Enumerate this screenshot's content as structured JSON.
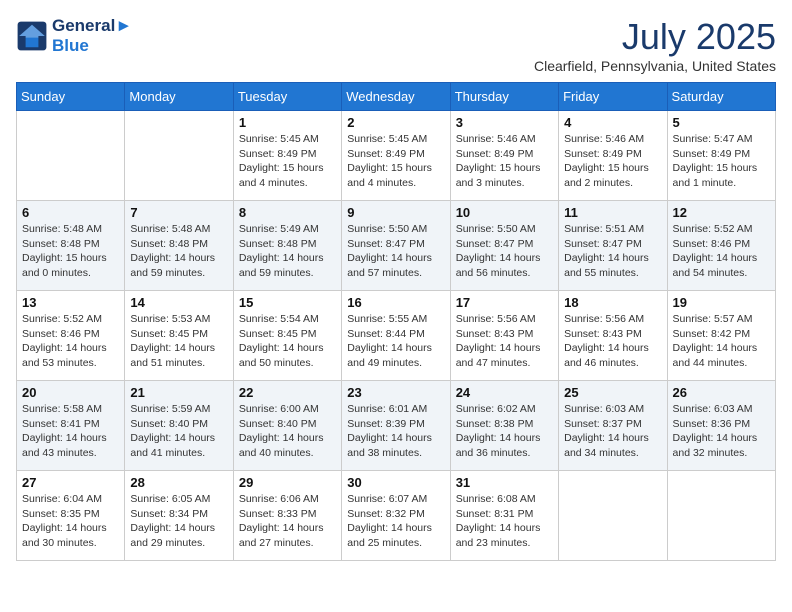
{
  "header": {
    "logo_line1": "General",
    "logo_line2": "Blue",
    "month": "July 2025",
    "location": "Clearfield, Pennsylvania, United States"
  },
  "days_of_week": [
    "Sunday",
    "Monday",
    "Tuesday",
    "Wednesday",
    "Thursday",
    "Friday",
    "Saturday"
  ],
  "weeks": [
    [
      {
        "day": "",
        "content": ""
      },
      {
        "day": "",
        "content": ""
      },
      {
        "day": "1",
        "content": "Sunrise: 5:45 AM\nSunset: 8:49 PM\nDaylight: 15 hours\nand 4 minutes."
      },
      {
        "day": "2",
        "content": "Sunrise: 5:45 AM\nSunset: 8:49 PM\nDaylight: 15 hours\nand 4 minutes."
      },
      {
        "day": "3",
        "content": "Sunrise: 5:46 AM\nSunset: 8:49 PM\nDaylight: 15 hours\nand 3 minutes."
      },
      {
        "day": "4",
        "content": "Sunrise: 5:46 AM\nSunset: 8:49 PM\nDaylight: 15 hours\nand 2 minutes."
      },
      {
        "day": "5",
        "content": "Sunrise: 5:47 AM\nSunset: 8:49 PM\nDaylight: 15 hours\nand 1 minute."
      }
    ],
    [
      {
        "day": "6",
        "content": "Sunrise: 5:48 AM\nSunset: 8:48 PM\nDaylight: 15 hours\nand 0 minutes."
      },
      {
        "day": "7",
        "content": "Sunrise: 5:48 AM\nSunset: 8:48 PM\nDaylight: 14 hours\nand 59 minutes."
      },
      {
        "day": "8",
        "content": "Sunrise: 5:49 AM\nSunset: 8:48 PM\nDaylight: 14 hours\nand 59 minutes."
      },
      {
        "day": "9",
        "content": "Sunrise: 5:50 AM\nSunset: 8:47 PM\nDaylight: 14 hours\nand 57 minutes."
      },
      {
        "day": "10",
        "content": "Sunrise: 5:50 AM\nSunset: 8:47 PM\nDaylight: 14 hours\nand 56 minutes."
      },
      {
        "day": "11",
        "content": "Sunrise: 5:51 AM\nSunset: 8:47 PM\nDaylight: 14 hours\nand 55 minutes."
      },
      {
        "day": "12",
        "content": "Sunrise: 5:52 AM\nSunset: 8:46 PM\nDaylight: 14 hours\nand 54 minutes."
      }
    ],
    [
      {
        "day": "13",
        "content": "Sunrise: 5:52 AM\nSunset: 8:46 PM\nDaylight: 14 hours\nand 53 minutes."
      },
      {
        "day": "14",
        "content": "Sunrise: 5:53 AM\nSunset: 8:45 PM\nDaylight: 14 hours\nand 51 minutes."
      },
      {
        "day": "15",
        "content": "Sunrise: 5:54 AM\nSunset: 8:45 PM\nDaylight: 14 hours\nand 50 minutes."
      },
      {
        "day": "16",
        "content": "Sunrise: 5:55 AM\nSunset: 8:44 PM\nDaylight: 14 hours\nand 49 minutes."
      },
      {
        "day": "17",
        "content": "Sunrise: 5:56 AM\nSunset: 8:43 PM\nDaylight: 14 hours\nand 47 minutes."
      },
      {
        "day": "18",
        "content": "Sunrise: 5:56 AM\nSunset: 8:43 PM\nDaylight: 14 hours\nand 46 minutes."
      },
      {
        "day": "19",
        "content": "Sunrise: 5:57 AM\nSunset: 8:42 PM\nDaylight: 14 hours\nand 44 minutes."
      }
    ],
    [
      {
        "day": "20",
        "content": "Sunrise: 5:58 AM\nSunset: 8:41 PM\nDaylight: 14 hours\nand 43 minutes."
      },
      {
        "day": "21",
        "content": "Sunrise: 5:59 AM\nSunset: 8:40 PM\nDaylight: 14 hours\nand 41 minutes."
      },
      {
        "day": "22",
        "content": "Sunrise: 6:00 AM\nSunset: 8:40 PM\nDaylight: 14 hours\nand 40 minutes."
      },
      {
        "day": "23",
        "content": "Sunrise: 6:01 AM\nSunset: 8:39 PM\nDaylight: 14 hours\nand 38 minutes."
      },
      {
        "day": "24",
        "content": "Sunrise: 6:02 AM\nSunset: 8:38 PM\nDaylight: 14 hours\nand 36 minutes."
      },
      {
        "day": "25",
        "content": "Sunrise: 6:03 AM\nSunset: 8:37 PM\nDaylight: 14 hours\nand 34 minutes."
      },
      {
        "day": "26",
        "content": "Sunrise: 6:03 AM\nSunset: 8:36 PM\nDaylight: 14 hours\nand 32 minutes."
      }
    ],
    [
      {
        "day": "27",
        "content": "Sunrise: 6:04 AM\nSunset: 8:35 PM\nDaylight: 14 hours\nand 30 minutes."
      },
      {
        "day": "28",
        "content": "Sunrise: 6:05 AM\nSunset: 8:34 PM\nDaylight: 14 hours\nand 29 minutes."
      },
      {
        "day": "29",
        "content": "Sunrise: 6:06 AM\nSunset: 8:33 PM\nDaylight: 14 hours\nand 27 minutes."
      },
      {
        "day": "30",
        "content": "Sunrise: 6:07 AM\nSunset: 8:32 PM\nDaylight: 14 hours\nand 25 minutes."
      },
      {
        "day": "31",
        "content": "Sunrise: 6:08 AM\nSunset: 8:31 PM\nDaylight: 14 hours\nand 23 minutes."
      },
      {
        "day": "",
        "content": ""
      },
      {
        "day": "",
        "content": ""
      }
    ]
  ]
}
